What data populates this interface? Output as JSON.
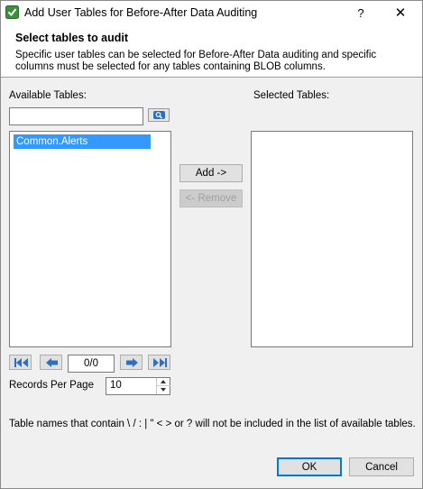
{
  "window": {
    "title": "Add User Tables for Before-After Data Auditing",
    "help_label": "?",
    "close_label": "✕"
  },
  "header": {
    "title": "Select tables to audit",
    "description": "Specific user tables can be selected for Before-After Data auditing and specific columns must be selected for any tables containing BLOB columns."
  },
  "available": {
    "label": "Available Tables:",
    "search_value": "",
    "items": [
      "Common.Alerts"
    ]
  },
  "selected": {
    "label": "Selected Tables:",
    "items": []
  },
  "buttons": {
    "add": "Add ->",
    "remove": "<- Remove",
    "ok": "OK",
    "cancel": "Cancel"
  },
  "pager": {
    "page_display": "0/0",
    "records_label": "Records Per Page",
    "records_value": "10"
  },
  "note": "Table names that contain \\ / : | \" < > or ? will not be included in the list of available tables.",
  "icons": {
    "app": "database-audit-icon",
    "search": "search-icon",
    "first": "first-page-icon",
    "prev": "previous-page-icon",
    "next": "next-page-icon",
    "last": "last-page-icon"
  },
  "colors": {
    "selection": "#3399ff",
    "default_button_border": "#0078d7",
    "window_bg": "#f0f0f0"
  }
}
